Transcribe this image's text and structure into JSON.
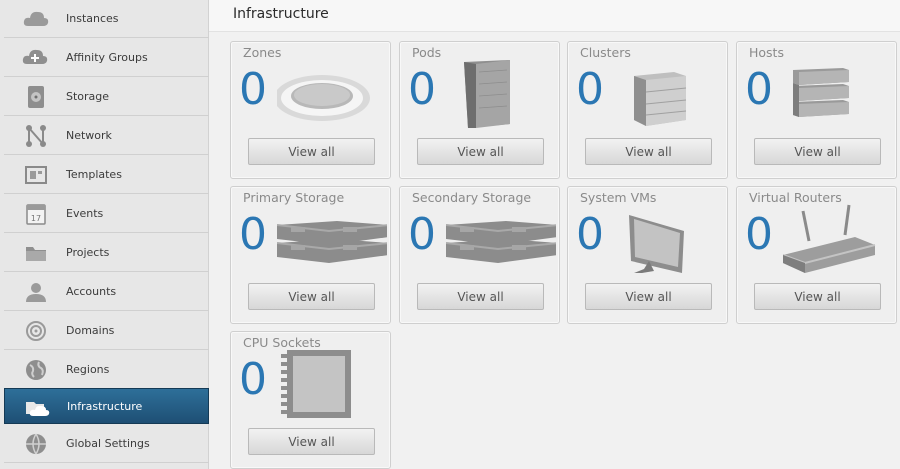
{
  "sidebar": {
    "items": [
      {
        "label": "Instances",
        "icon": "cloud-icon"
      },
      {
        "label": "Affinity Groups",
        "icon": "cloud-affinity-icon"
      },
      {
        "label": "Storage",
        "icon": "disk-icon"
      },
      {
        "label": "Network",
        "icon": "network-icon"
      },
      {
        "label": "Templates",
        "icon": "templates-icon"
      },
      {
        "label": "Events",
        "icon": "calendar-icon"
      },
      {
        "label": "Projects",
        "icon": "folder-icon"
      },
      {
        "label": "Accounts",
        "icon": "user-icon"
      },
      {
        "label": "Domains",
        "icon": "domains-icon"
      },
      {
        "label": "Regions",
        "icon": "globe-icon"
      },
      {
        "label": "Infrastructure",
        "icon": "infrastructure-icon",
        "active": true
      },
      {
        "label": "Global Settings",
        "icon": "settings-globe-icon"
      }
    ],
    "calendar_day": "17"
  },
  "main": {
    "title": "Infrastructure",
    "tiles": [
      {
        "title": "Zones",
        "count": "0",
        "button": "View all",
        "icon": "zone-icon"
      },
      {
        "title": "Pods",
        "count": "0",
        "button": "View all",
        "icon": "pod-rack-icon"
      },
      {
        "title": "Clusters",
        "count": "0",
        "button": "View all",
        "icon": "cluster-icon"
      },
      {
        "title": "Hosts",
        "count": "0",
        "button": "View all",
        "icon": "host-icon"
      },
      {
        "title": "Primary Storage",
        "count": "0",
        "button": "View all",
        "icon": "primary-storage-icon"
      },
      {
        "title": "Secondary Storage",
        "count": "0",
        "button": "View all",
        "icon": "secondary-storage-icon"
      },
      {
        "title": "System VMs",
        "count": "0",
        "button": "View all",
        "icon": "monitor-icon"
      },
      {
        "title": "Virtual Routers",
        "count": "0",
        "button": "View all",
        "icon": "router-icon"
      },
      {
        "title": "CPU Sockets",
        "count": "0",
        "button": "View all",
        "icon": "cpu-icon"
      }
    ]
  },
  "colors": {
    "accent": "#2b77b3",
    "active_nav": "#255f88"
  }
}
